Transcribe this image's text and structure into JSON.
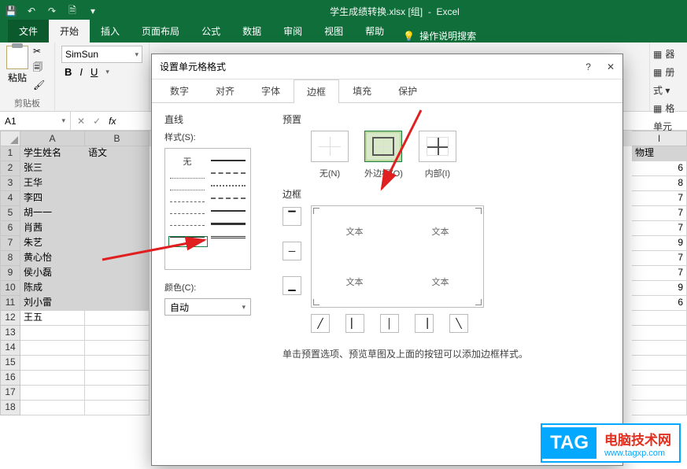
{
  "titlebar": {
    "filename": "学生成绩转换.xlsx [组]",
    "app": "Excel"
  },
  "ribbon": {
    "tabs": {
      "file": "文件",
      "home": "开始",
      "insert": "插入",
      "layout": "页面布局",
      "formula": "公式",
      "data": "数据",
      "review": "审阅",
      "view": "视图",
      "help": "帮助",
      "tell": "操作说明搜索"
    },
    "clip": {
      "paste": "粘贴",
      "group": "剪贴板"
    },
    "font": {
      "name": "SimSun",
      "bold": "B",
      "italic": "I",
      "underline": "U"
    },
    "right": {
      "i1": "器",
      "i2": "册",
      "i3": "格",
      "group": "单元"
    }
  },
  "namebox": "A1",
  "columns": [
    "A",
    "B",
    "I"
  ],
  "rows": [
    {
      "n": "1",
      "a": "学生姓名",
      "b": "语文",
      "i": "物理"
    },
    {
      "n": "2",
      "a": "张三",
      "b": "",
      "i": "6"
    },
    {
      "n": "3",
      "a": "王华",
      "b": "",
      "i": "8"
    },
    {
      "n": "4",
      "a": "李四",
      "b": "",
      "i": "7"
    },
    {
      "n": "5",
      "a": "胡一一",
      "b": "",
      "i": "7"
    },
    {
      "n": "6",
      "a": "肖茜",
      "b": "",
      "i": "7"
    },
    {
      "n": "7",
      "a": "朱艺",
      "b": "",
      "i": "9"
    },
    {
      "n": "8",
      "a": "黄心怡",
      "b": "",
      "i": "7"
    },
    {
      "n": "9",
      "a": "侯小磊",
      "b": "",
      "i": "7"
    },
    {
      "n": "10",
      "a": "陈成",
      "b": "",
      "i": "9"
    },
    {
      "n": "11",
      "a": "刘小雷",
      "b": "",
      "i": "6"
    },
    {
      "n": "12",
      "a": "王五",
      "b": "",
      "i": ""
    },
    {
      "n": "13",
      "a": "",
      "b": "",
      "i": ""
    },
    {
      "n": "14",
      "a": "",
      "b": "",
      "i": ""
    },
    {
      "n": "15",
      "a": "",
      "b": "",
      "i": ""
    },
    {
      "n": "16",
      "a": "",
      "b": "",
      "i": ""
    },
    {
      "n": "17",
      "a": "",
      "b": "",
      "i": ""
    },
    {
      "n": "18",
      "a": "",
      "b": "",
      "i": ""
    }
  ],
  "dialog": {
    "title": "设置单元格格式",
    "tabs": {
      "num": "数字",
      "align": "对齐",
      "font": "字体",
      "border": "边框",
      "fill": "填充",
      "protect": "保护"
    },
    "line": {
      "sec": "直线",
      "style": "样式(S):",
      "none": "无",
      "colorlbl": "颜色(C):",
      "colorval": "自动"
    },
    "presets": {
      "sec": "预置",
      "none": "无(N)",
      "outer": "外边框(O)",
      "inner": "内部(I)"
    },
    "bordersec": "边框",
    "previewtxt": "文本",
    "hint": "单击预置选项、预览草图及上面的按钮可以添加边框样式。"
  },
  "badge": {
    "tag": "TAG",
    "l1": "电脑技术网",
    "l2": "www.tagxp.com"
  }
}
